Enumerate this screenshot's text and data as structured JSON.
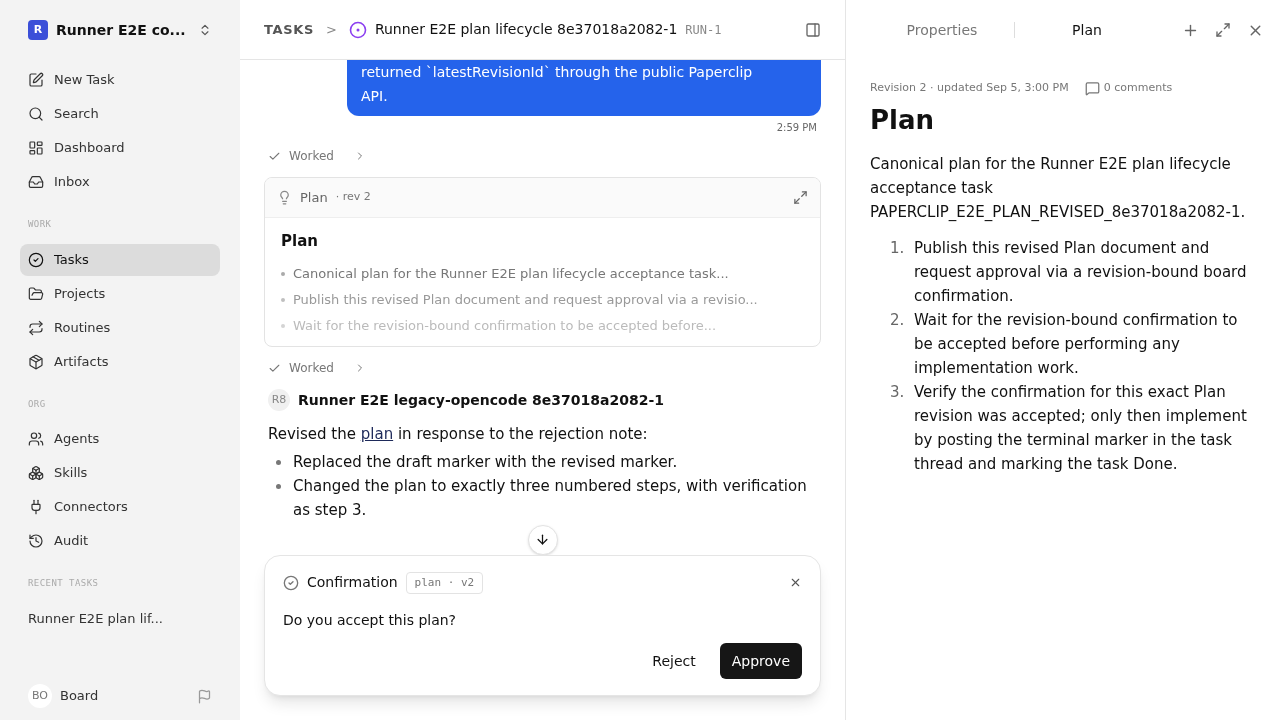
{
  "sidebar": {
    "workspace": {
      "initial": "R",
      "name": "Runner E2E co..."
    },
    "top_items": [
      {
        "label": "New Task"
      },
      {
        "label": "Search"
      },
      {
        "label": "Dashboard"
      },
      {
        "label": "Inbox"
      }
    ],
    "sections": [
      {
        "title": "WORK",
        "items": [
          {
            "label": "Tasks",
            "selected": true
          },
          {
            "label": "Projects",
            "selected": false
          },
          {
            "label": "Routines",
            "selected": false
          },
          {
            "label": "Artifacts",
            "selected": false
          }
        ]
      },
      {
        "title": "ORG",
        "items": [
          {
            "label": "Agents",
            "selected": false
          },
          {
            "label": "Skills",
            "selected": false
          },
          {
            "label": "Connectors",
            "selected": false
          },
          {
            "label": "Audit",
            "selected": false
          }
        ]
      }
    ],
    "recent": {
      "title": "RECENT TASKS",
      "items": [
        "Runner E2E plan lif..."
      ]
    },
    "user": {
      "initials": "BO",
      "name": "Board"
    }
  },
  "header": {
    "crumb": "TASKS",
    "sep": ">",
    "title": "Runner E2E plan lifecycle 8e37018a2082-1",
    "id": "RUN-1"
  },
  "chat": {
    "bubble_lines": [
      "returned `latestRevisionId` through the public Paperclip",
      "API."
    ],
    "bubble_time": "2:59 PM",
    "worked": [
      "Worked",
      "Worked"
    ],
    "plan_card": {
      "label": "Plan",
      "rev": "· rev 2",
      "title": "Plan",
      "bullets": [
        "Canonical plan for the Runner E2E plan lifecycle acceptance task...",
        "Publish this revised Plan document and request approval via a revisio...",
        "Wait for the revision-bound confirmation to be accepted before..."
      ]
    },
    "author": {
      "initials": "R8",
      "name": "Runner E2E legacy-opencode 8e37018a2082-1"
    },
    "intro": {
      "before": "Revised the",
      "link": "plan",
      "after": "in response to the rejection note:"
    },
    "bullets": [
      "Replaced the draft marker with the revised marker.",
      "Changed the plan to exactly three numbered steps, with verification as step 3."
    ]
  },
  "confirmation": {
    "title": "Confirmation",
    "tag": "plan · v2",
    "question": "Do you accept this plan?",
    "buttons": [
      {
        "label": "Reject",
        "kind": "secondary"
      },
      {
        "label": "Approve",
        "kind": "primary"
      }
    ]
  },
  "panel": {
    "tabs": [
      {
        "label": "Properties",
        "selected": false
      },
      {
        "label": "Plan",
        "selected": true
      }
    ],
    "meta": "Revision 2 · updated Sep 5, 3:00 PM",
    "comments": "0 comments",
    "title": "Plan",
    "intro": "Canonical plan for the Runner E2E plan lifecycle acceptance task PAPERCLIP_E2E_PLAN_REVISED_8e37018a2082-1.",
    "steps": [
      {
        "number": "1.",
        "text": "Publish this revised Plan document and request approval via a revision-bound board confirmation."
      },
      {
        "number": "2.",
        "text": "Wait for the revision-bound confirmation to be accepted before performing any implementation work."
      },
      {
        "number": "3.",
        "text": "Verify the confirmation for this exact Plan revision was accepted; only then implement by posting the terminal marker in the task thread and marking the task Done."
      }
    ]
  }
}
